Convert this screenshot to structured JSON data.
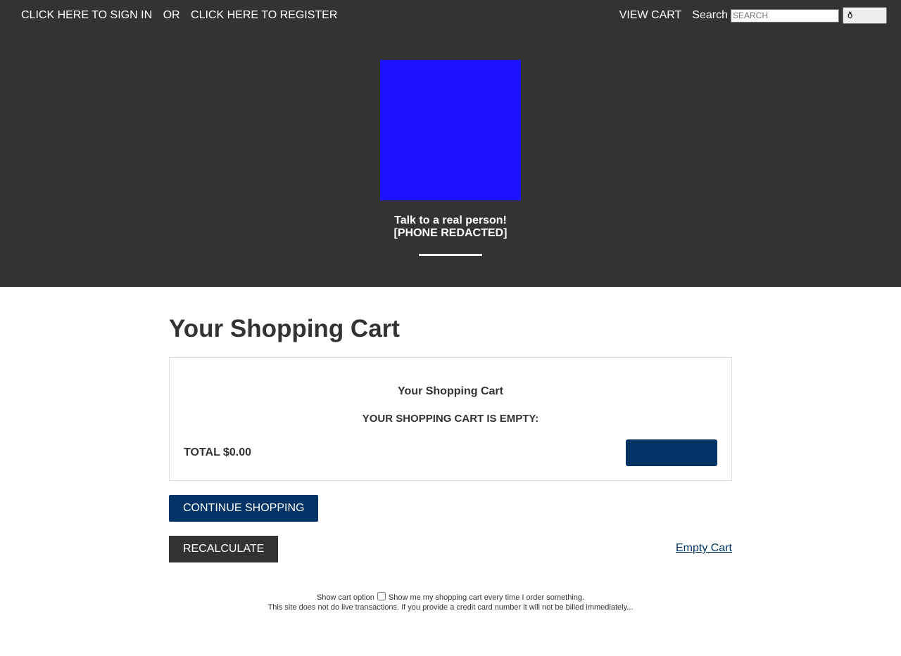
{
  "topbar": {
    "sign_in": "CLICK HERE TO SIGN IN",
    "or": "OR",
    "register": "CLICK HERE TO REGISTER",
    "view_cart": "VIEW CART",
    "search_label": "Search",
    "search_placeholder": "SEARCH",
    "search_button": "ð"
  },
  "header": {
    "logo_color": "#1c12ff",
    "talk_line1": "Talk to a real person!",
    "talk_line2": "[PHONE REDACTED]"
  },
  "main": {
    "title": "Your Shopping Cart",
    "cart_box_title": "Your Shopping Cart",
    "cart_empty": "YOUR SHOPPING CART IS EMPTY:",
    "total": "TOTAL $0.00",
    "continue_shopping": "CONTINUE SHOPPING",
    "recalculate": "RECALCULATE",
    "empty_cart": "Empty Cart"
  },
  "footer": {
    "show_cart_label": "Show cart option",
    "show_cart_text": "Show me my shopping cart every time I order something.",
    "disclaimer": "This site does not do live transactions. If you provide a credit card number it will not be billed immediately..."
  },
  "colors": {
    "header_bg": "#333333",
    "primary_button": "#003366",
    "dark_button": "#333333"
  }
}
